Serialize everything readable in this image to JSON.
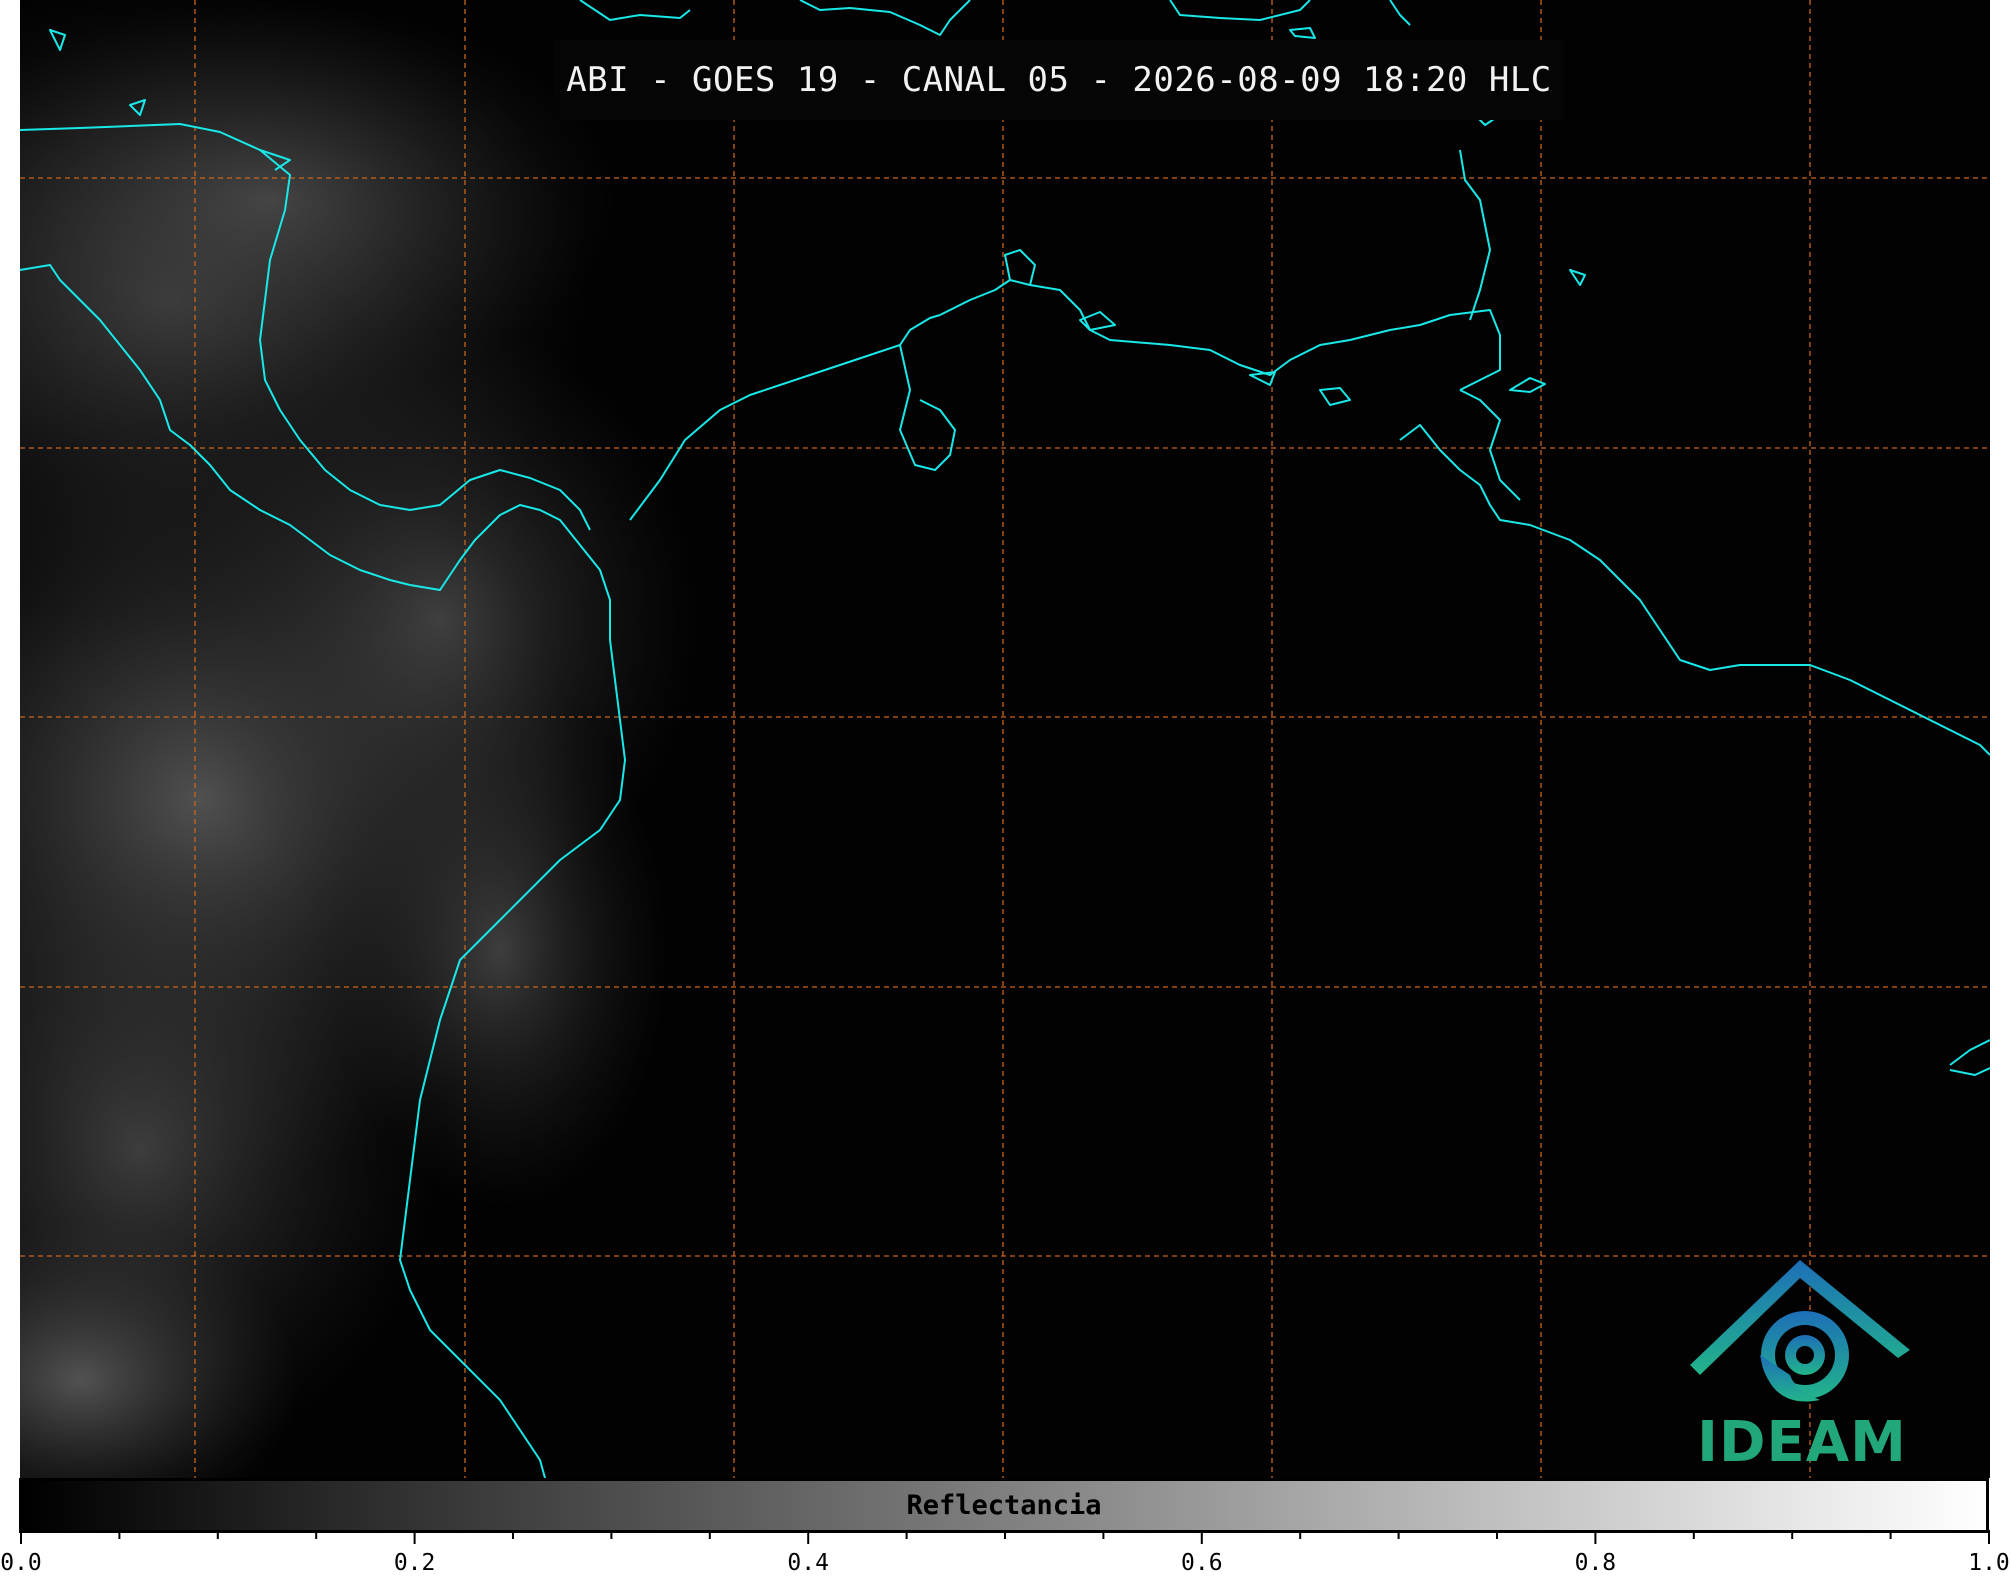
{
  "title": "ABI - GOES 19 - CANAL 05 - 2026-08-09 18:20 HLC",
  "logo": {
    "text": "IDEAM",
    "color": "#22a77a",
    "accent": "#1d7fb0"
  },
  "colorbar": {
    "label": "Reflectancia",
    "ticks": [
      "0.0",
      "0.2",
      "0.4",
      "0.6",
      "0.8",
      "1.0"
    ],
    "range": [
      0.0,
      1.0
    ],
    "colormap": "grayscale"
  },
  "map": {
    "coastline_color": "#19e8e8",
    "graticule_color": "#c8641e",
    "graticule_style": "dashed"
  }
}
